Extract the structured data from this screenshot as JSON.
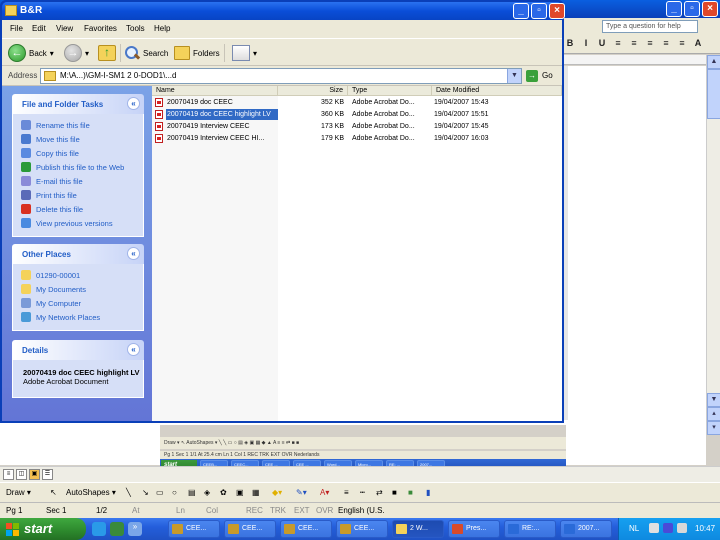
{
  "explorer": {
    "title": "B&R",
    "menu": [
      "File",
      "Edit",
      "View",
      "Favorites",
      "Tools",
      "Help"
    ],
    "toolbar": {
      "back": "Back",
      "search": "Search",
      "folders": "Folders"
    },
    "address": {
      "label": "Address",
      "path": "M:\\A...)\\GM-I-SM1 2 0-DOD1\\...d",
      "go": "Go"
    },
    "panels": {
      "file_tasks": {
        "title": "File and Folder Tasks",
        "items": [
          {
            "label": "Rename this file",
            "icon": "rename-icon"
          },
          {
            "label": "Move this file",
            "icon": "move-icon"
          },
          {
            "label": "Copy this file",
            "icon": "copy-icon"
          },
          {
            "label": "Publish this file to the Web",
            "icon": "publish-icon"
          },
          {
            "label": "E-mail this file",
            "icon": "email-icon"
          },
          {
            "label": "Print this file",
            "icon": "print-icon"
          },
          {
            "label": "Delete this file",
            "icon": "delete-icon"
          },
          {
            "label": "View previous versions",
            "icon": "versions-icon"
          }
        ]
      },
      "other_places": {
        "title": "Other Places",
        "items": [
          {
            "label": "01290-00001",
            "icon": "folder-icon"
          },
          {
            "label": "My Documents",
            "icon": "my-documents-icon"
          },
          {
            "label": "My Computer",
            "icon": "my-computer-icon"
          },
          {
            "label": "My Network Places",
            "icon": "network-places-icon"
          }
        ]
      },
      "details": {
        "title": "Details",
        "name": "20070419 doc CEEC highlight LV",
        "type": "Adobe Acrobat Document"
      }
    },
    "columns": [
      "Name",
      "Size",
      "Type",
      "Date Modified"
    ],
    "files": [
      {
        "name": "20070419 doc CEEC",
        "size": "352 KB",
        "type": "Adobe Acrobat Do...",
        "date": "19/04/2007 15:43",
        "selected": false
      },
      {
        "name": "20070419 doc CEEC highlight LV",
        "size": "360 KB",
        "type": "Adobe Acrobat Do...",
        "date": "19/04/2007 15:51",
        "selected": true
      },
      {
        "name": "20070419 Interview CEEC",
        "size": "173 KB",
        "type": "Adobe Acrobat Do...",
        "date": "19/04/2007 15:45",
        "selected": false
      },
      {
        "name": "20070419 Interview CEEC HI...",
        "size": "179 KB",
        "type": "Adobe Acrobat Do...",
        "date": "19/04/2007 16:03",
        "selected": false
      }
    ]
  },
  "word": {
    "help_placeholder": "Type a question for help",
    "fmt_buttons": [
      "B",
      "I",
      "U",
      "≡",
      "≡",
      "≡",
      "≡",
      "≡",
      "A"
    ],
    "draw_toolbar": {
      "draw": "Draw ▾",
      "autoshapes": "AutoShapes ▾"
    },
    "status": {
      "page": "Pg 1",
      "sec": "Sec 1",
      "pages": "1/2",
      "at": "At",
      "ln": "Ln",
      "col": "Col",
      "rec": "REC",
      "trk": "TRK",
      "ext": "EXT",
      "ovr": "OVR",
      "lang": "English (U.S."
    },
    "nested": {
      "draw_text": "Draw ▾  ↖  AutoShapes ▾  ╲  ╲  ▭  ○  ▤  ◈  ▣  ▦  ◆  ▲  A  ≡  ≡  ⇄  ■  ■",
      "status_text": "Pg 1    Sec 1    1/1    At 25.4 cm    Ln 1    Col 1    REC  TRK  EXT  OVR   Nederlands",
      "start": "start",
      "tasks": [
        "CEEB...",
        "CEEC...",
        "CEE ...",
        "CEE ...",
        "Word...",
        "Micro...",
        "RE: ...",
        "2007..."
      ]
    }
  },
  "taskbar": {
    "start": "start",
    "buttons": [
      {
        "label": "CEE...",
        "color": "#c89a2a",
        "active": false
      },
      {
        "label": "CEE...",
        "color": "#c89a2a",
        "active": false
      },
      {
        "label": "CEE...",
        "color": "#c89a2a",
        "active": false
      },
      {
        "label": "CEE...",
        "color": "#c89a2a",
        "active": false
      },
      {
        "label": "2 W...",
        "color": "#f4d25a",
        "active": true
      },
      {
        "label": "Pres...",
        "color": "#d84a2a",
        "active": false
      },
      {
        "label": "RE:...",
        "color": "#2a6ad8",
        "active": false
      },
      {
        "label": "2007...",
        "color": "#2a6ad8",
        "active": false
      }
    ],
    "tray": {
      "lang": "NL",
      "clock": "10:47"
    }
  }
}
